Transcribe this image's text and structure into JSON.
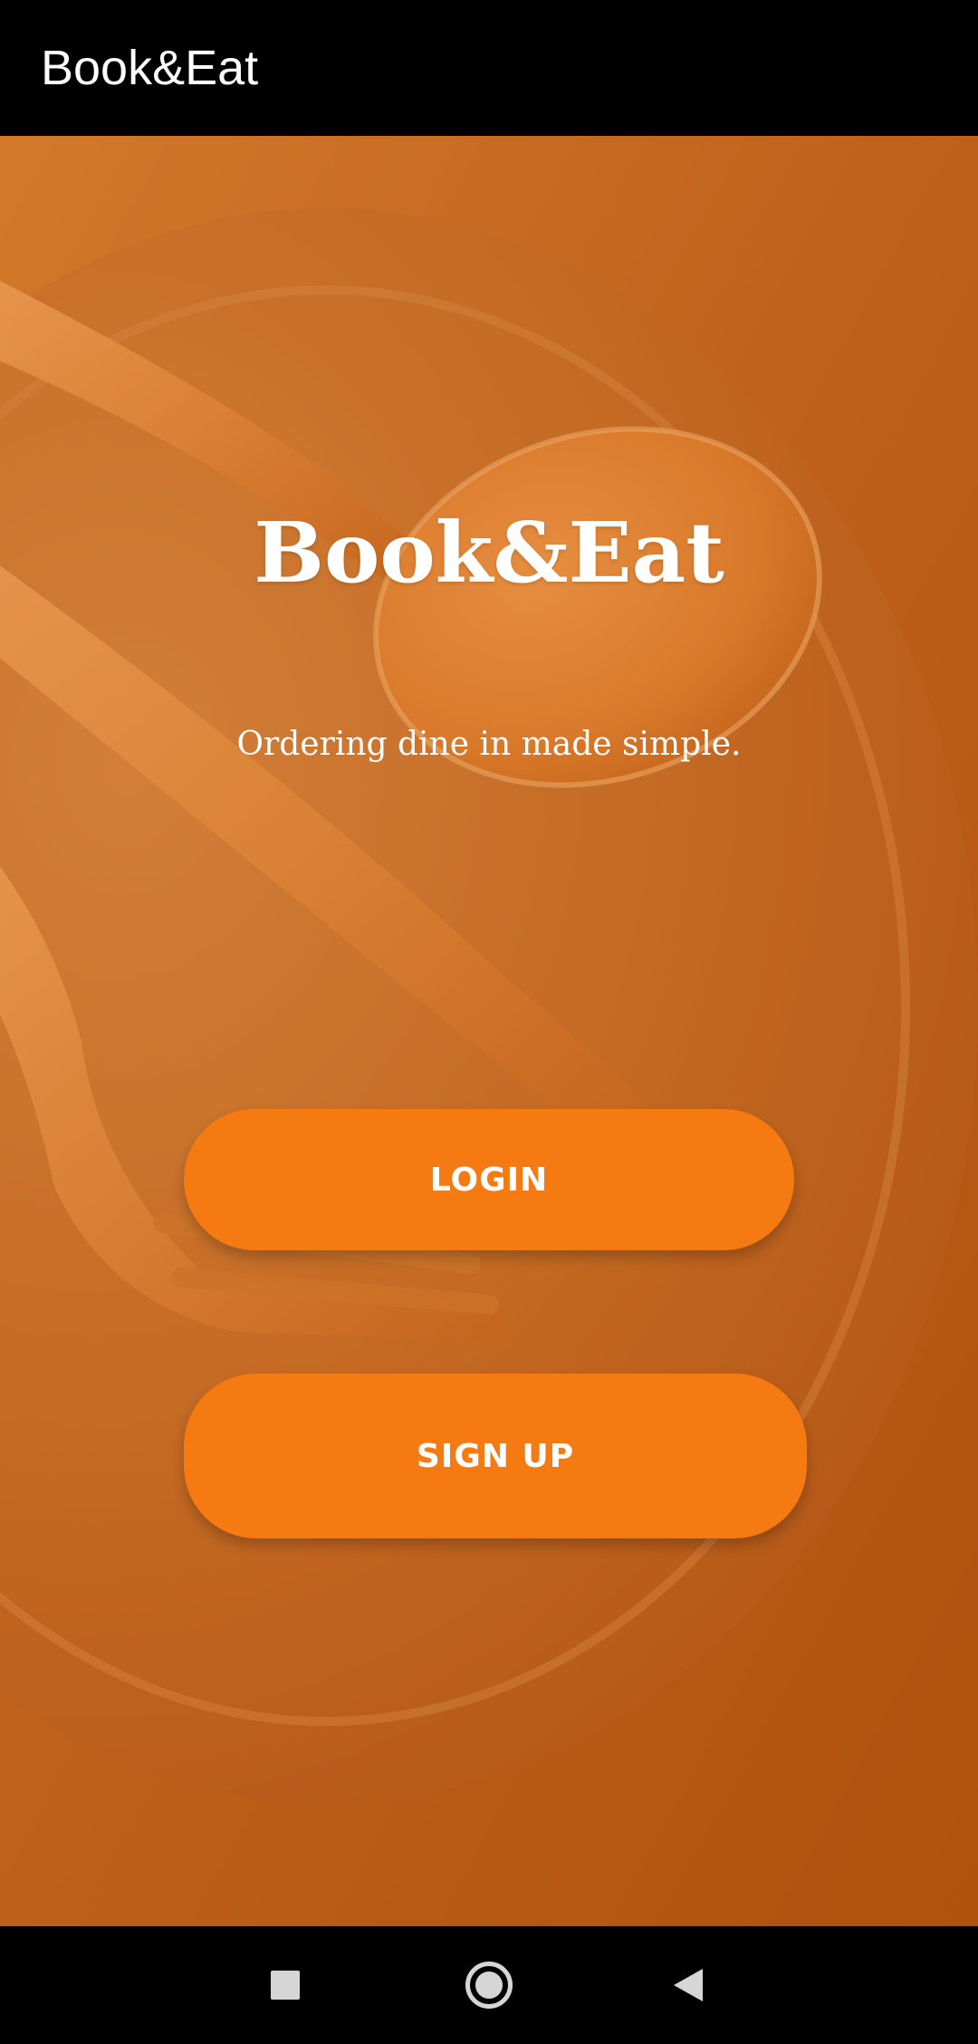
{
  "app_bar": {
    "title": "Book&Eat"
  },
  "hero": {
    "title": "Book&Eat",
    "tagline": "Ordering dine in made simple."
  },
  "actions": {
    "login_label": "LOGIN",
    "signup_label": "SIGN UP"
  },
  "nav": {
    "recents_icon": "square-icon",
    "home_icon": "circle-home-icon",
    "back_icon": "triangle-back-icon"
  },
  "colors": {
    "accent": "#f57a12",
    "background_tint": "#c2661d",
    "bar": "#000000"
  }
}
